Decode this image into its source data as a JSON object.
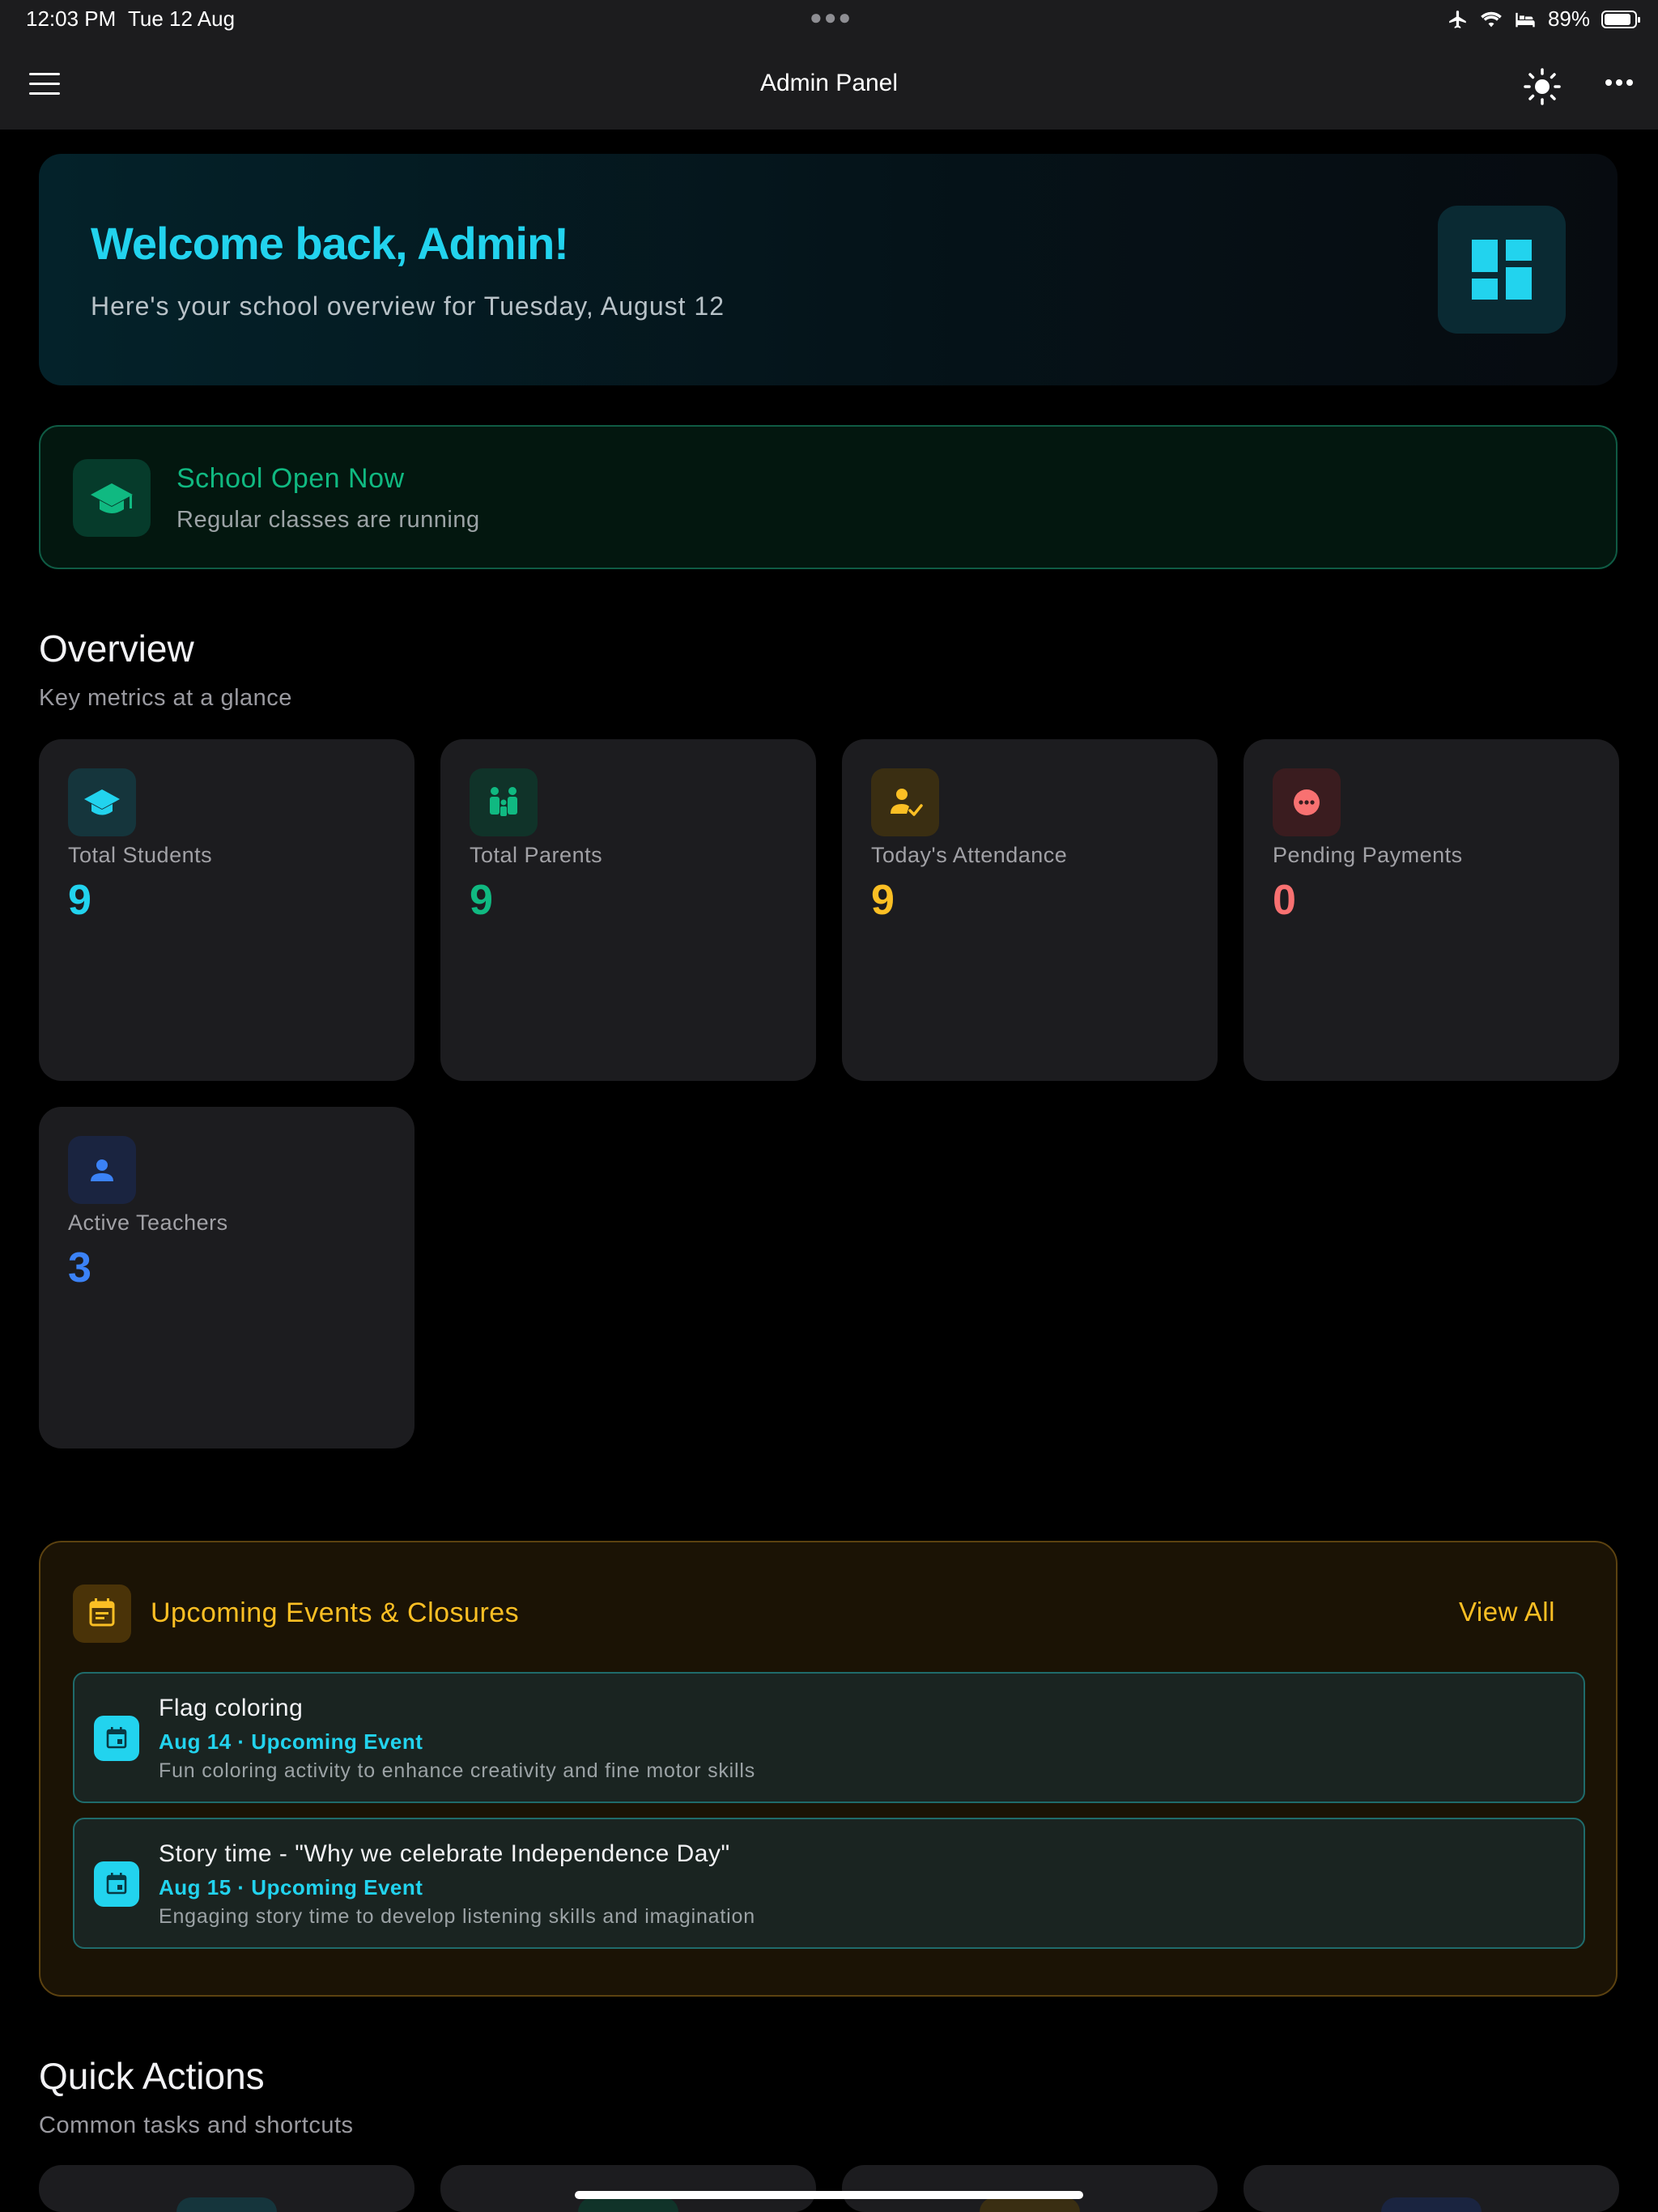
{
  "status_bar": {
    "time": "12:03 PM",
    "date": "Tue 12 Aug",
    "battery": "89%"
  },
  "header": {
    "title": "Admin Panel"
  },
  "welcome": {
    "title": "Welcome back, Admin!",
    "subtitle": "Here's your school overview for Tuesday, August 12"
  },
  "school_status": {
    "title": "School Open Now",
    "subtitle": "Regular classes are running"
  },
  "overview": {
    "title": "Overview",
    "subtitle": "Key metrics at a glance",
    "stats": [
      {
        "label": "Total Students",
        "value": "9",
        "color": "#22d3ee",
        "icon": "graduation-cap-icon"
      },
      {
        "label": "Total Parents",
        "value": "9",
        "color": "#10b981",
        "icon": "family-icon"
      },
      {
        "label": "Today's Attendance",
        "value": "9",
        "color": "#fbbf24",
        "icon": "attendance-check-icon"
      },
      {
        "label": "Pending Payments",
        "value": "0",
        "color": "#f87171",
        "icon": "pending-dots-icon"
      },
      {
        "label": "Active Teachers",
        "value": "3",
        "color": "#3b82f6",
        "icon": "person-icon"
      }
    ]
  },
  "events": {
    "title": "Upcoming Events & Closures",
    "view_all": "View All",
    "items": [
      {
        "title": "Flag coloring",
        "meta": "Aug 14 · Upcoming Event",
        "description": "Fun coloring activity to enhance creativity and fine motor skills"
      },
      {
        "title": "Story time - \"Why we celebrate Independence Day\"",
        "meta": "Aug 15 · Upcoming Event",
        "description": "Engaging story time to develop listening skills and imagination"
      }
    ]
  },
  "quick_actions": {
    "title": "Quick Actions",
    "subtitle": "Common tasks and shortcuts"
  },
  "colors": {
    "accent_cyan": "#22d3ee",
    "accent_green": "#10b981",
    "accent_amber": "#fbbf24",
    "accent_red": "#f87171",
    "accent_blue": "#3b82f6"
  }
}
